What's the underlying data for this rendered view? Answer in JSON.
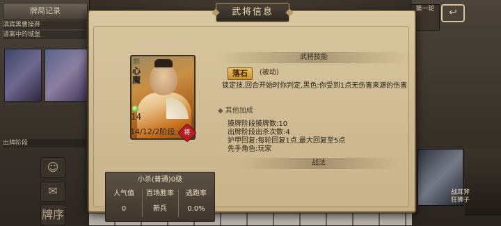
{
  "background": {
    "left_tab": "牌局记录",
    "left_lines": [
      "滇宾黑曹操弃",
      "请离中的城堡"
    ],
    "left_section": "出牌阶段",
    "left_button": "牌序",
    "rank_text": "第一轮",
    "right_name": [
      "战耳斧",
      "狂狮子"
    ]
  },
  "dialog": {
    "title": "武将信息",
    "general": {
      "kingdom": "群",
      "name_chars": [
        "心",
        "魔"
      ],
      "hp": "14",
      "stage_text": "14/12/2阶段",
      "badge": "将"
    },
    "stats": {
      "title": "小杀(普通)0级",
      "columns": [
        {
          "label": "人气值",
          "value": "0"
        },
        {
          "label": "百场胜率",
          "value": "新兵"
        },
        {
          "label": "逃跑率",
          "value": "0.0%"
        }
      ]
    },
    "skills": {
      "header": "武将技能",
      "skill_name": "落石",
      "skill_type": "(被动)",
      "skill_desc": "锁定技,回合开始时你判定,黑色:你受到1点无伤害来源的伤害",
      "other_toggle": "其他加成",
      "info": [
        "摸牌阶段摸牌数:10",
        "出牌阶段出杀次数:4",
        "护甲回复:每轮回复1点,最大回复至5点",
        "先手角色:玩家"
      ],
      "tactics_header": "战法"
    }
  }
}
